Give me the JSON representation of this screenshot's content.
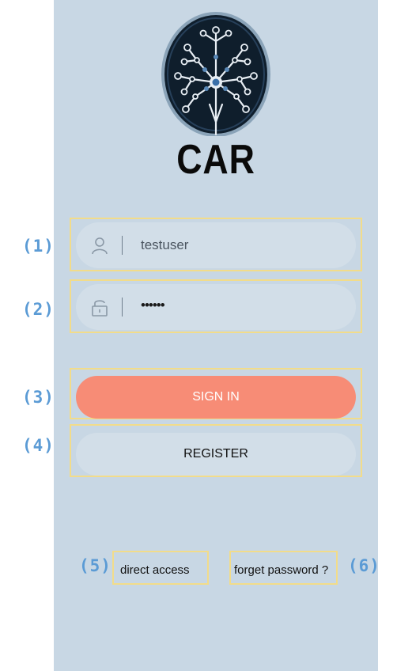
{
  "app": {
    "logo_text": "CAR"
  },
  "form": {
    "username_value": "testuser",
    "password_value": "••••••",
    "username_icon": "user-icon",
    "password_icon": "lock-icon"
  },
  "buttons": {
    "signin_label": "SIGN IN",
    "register_label": "REGISTER"
  },
  "links": {
    "direct_access_label": "direct access",
    "forget_password_label": "forget password ?"
  },
  "annotations": {
    "n1": "(1)",
    "n2": "(2)",
    "n3": "(3)",
    "n4": "(4)",
    "n5": "(5)",
    "n6": "(6)"
  },
  "colors": {
    "screen_bg": "#c8d7e4",
    "field_bg": "#d2dee8",
    "primary": "#f78c76",
    "annotation_box": "#f2dc8a",
    "annotation_text": "#5b9bd5"
  }
}
